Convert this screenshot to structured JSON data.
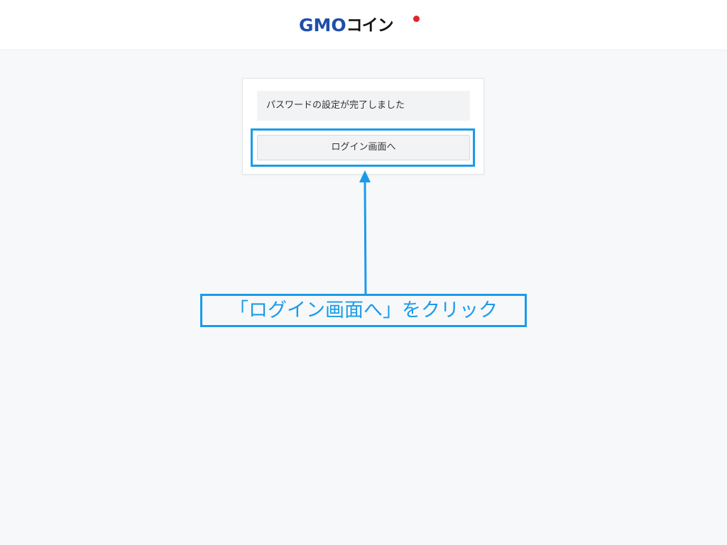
{
  "header": {
    "logo_gmo": "GMO",
    "logo_coin": "コイン"
  },
  "card": {
    "message": "パスワードの設定が完了しました",
    "login_button_label": "ログイン画面へ"
  },
  "annotation": {
    "callout_text": "「ログイン画面へ」をクリック",
    "accent_color": "#1a9bea"
  },
  "colors": {
    "logo_blue": "#1f4fa7",
    "logo_red_dot": "#e0262e",
    "page_background": "#f7f8f9"
  }
}
